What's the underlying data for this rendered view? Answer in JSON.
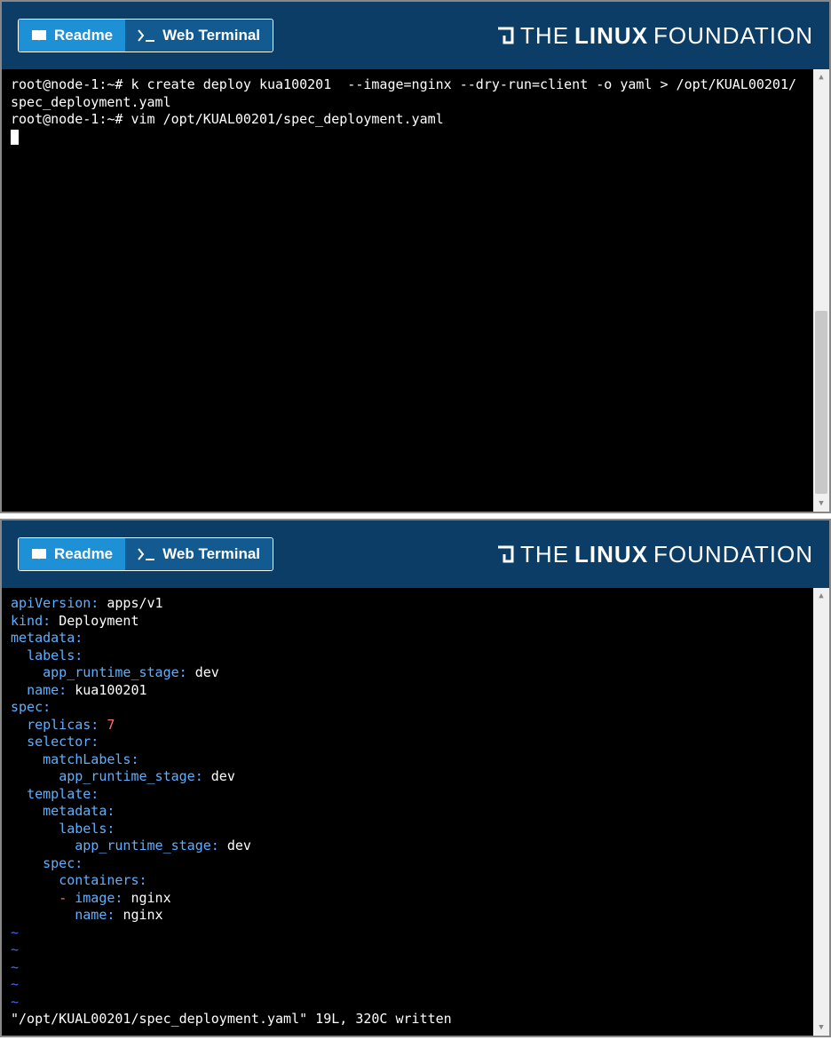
{
  "header": {
    "tab_readme": "Readme",
    "tab_terminal": "Web Terminal",
    "logo_the": "THE",
    "logo_linux": "LINUX",
    "logo_foundation": "FOUNDATION"
  },
  "terminal1": {
    "prompt1": "root@node-1:~#",
    "cmd1": "k create deploy kua100201  --image=nginx --dry-run=client -o yaml > /opt/KUAL00201/spec_deployment.yaml",
    "prompt2": "root@node-1:~#",
    "cmd2": "vim /opt/KUAL00201/spec_deployment.yaml"
  },
  "yaml": {
    "apiVersion_k": "apiVersion:",
    "apiVersion_v": "apps/v1",
    "kind_k": "kind:",
    "kind_v": "Deployment",
    "metadata_k": "metadata:",
    "labels_k": "labels:",
    "app_stage_k": "app_runtime_stage:",
    "app_stage_v": "dev",
    "name_k": "name:",
    "name_v": "kua100201",
    "spec_k": "spec:",
    "replicas_k": "replicas:",
    "replicas_v": "7",
    "selector_k": "selector:",
    "matchLabels_k": "matchLabels:",
    "template_k": "template:",
    "containers_k": "containers:",
    "dash": "-",
    "image_k": "image:",
    "image_v": "nginx",
    "cname_k": "name:",
    "cname_v": "nginx",
    "tilde": "~",
    "status": "\"/opt/KUAL00201/spec_deployment.yaml\" 19L, 320C written"
  }
}
